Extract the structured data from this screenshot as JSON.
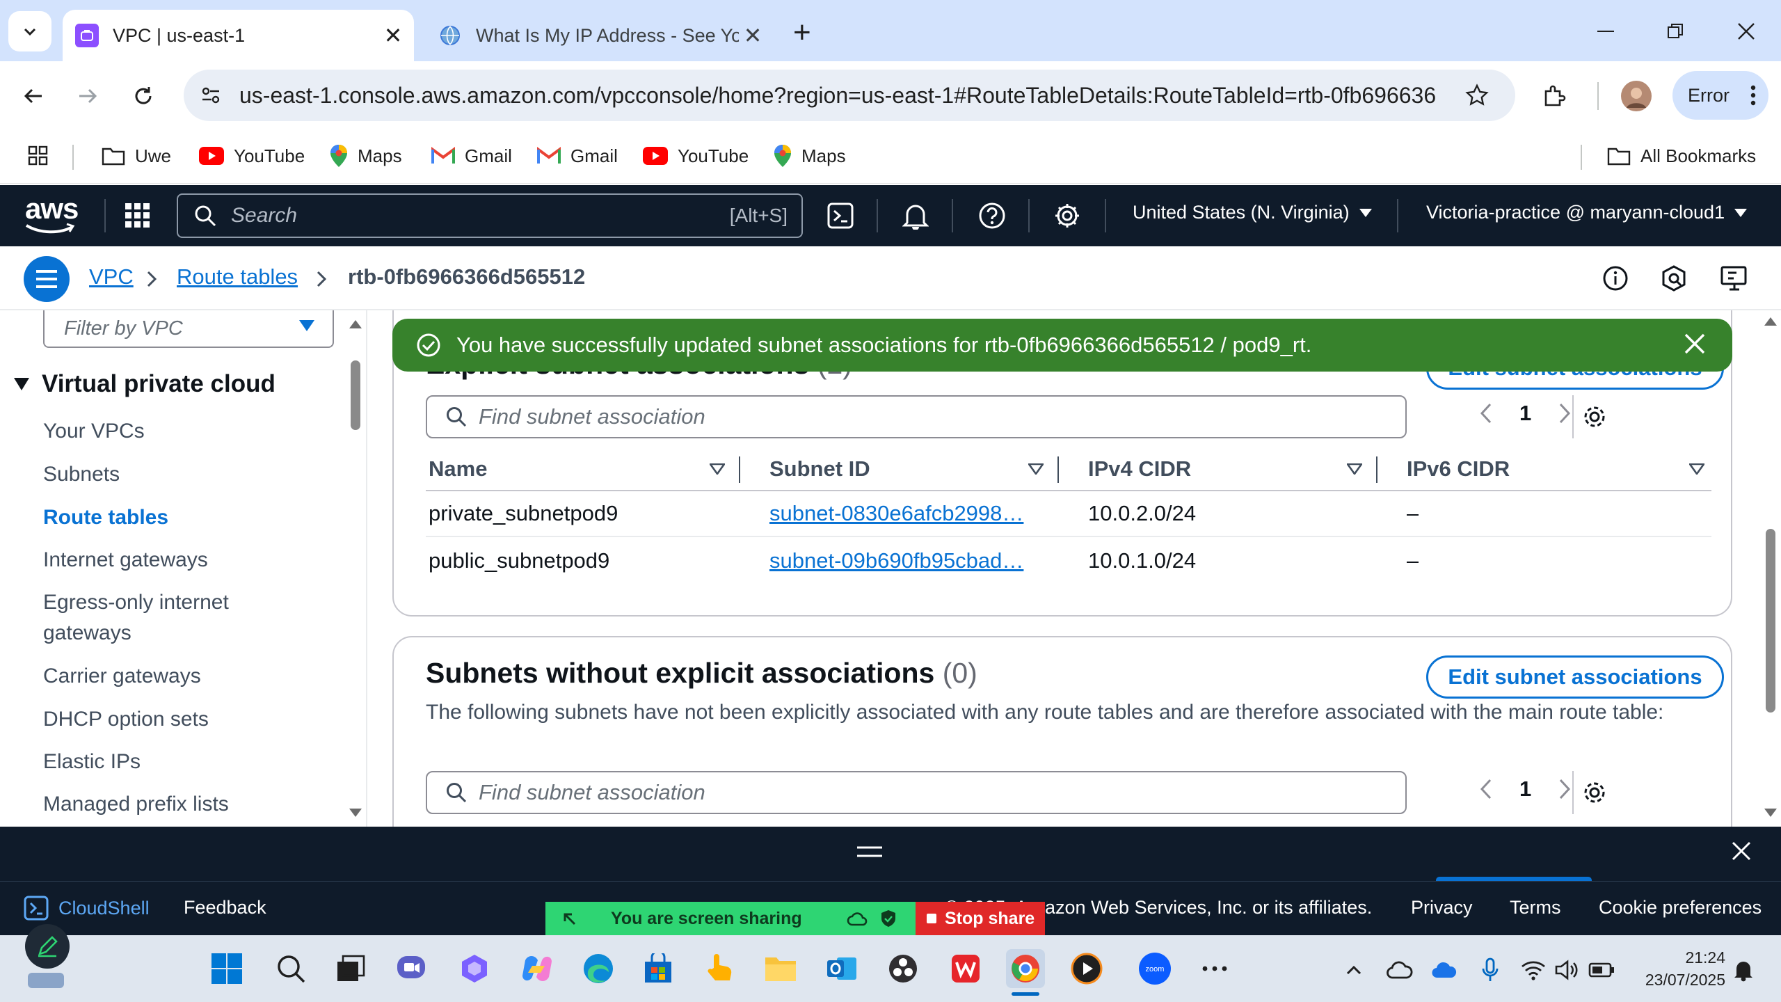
{
  "browser": {
    "tabs": [
      {
        "title": "VPC | us-east-1",
        "active": true
      },
      {
        "title": "What Is My IP Address - See Yo",
        "active": false
      }
    ],
    "url": "us-east-1.console.aws.amazon.com/vpcconsole/home?region=us-east-1#RouteTableDetails:RouteTableId=rtb-0fb6966366d56...",
    "profile_status": "Error",
    "bookmarks": [
      "Uwe",
      "YouTube",
      "Maps",
      "Gmail",
      "Gmail",
      "YouTube",
      "Maps"
    ],
    "all_bookmarks": "All Bookmarks"
  },
  "aws_header": {
    "logo": "aws",
    "search_placeholder": "Search",
    "search_shortcut": "[Alt+S]",
    "region": "United States (N. Virginia)",
    "account": "Victoria-practice @ maryann-cloud1"
  },
  "breadcrumb": {
    "items": [
      "VPC",
      "Route tables"
    ],
    "current": "rtb-0fb6966366d565512"
  },
  "sidebar": {
    "filter_placeholder": "Filter by VPC",
    "section": "Virtual private cloud",
    "items": [
      {
        "label": "Your VPCs",
        "active": false
      },
      {
        "label": "Subnets",
        "active": false
      },
      {
        "label": "Route tables",
        "active": true
      },
      {
        "label": "Internet gateways",
        "active": false
      },
      {
        "label": "Egress-only internet gateways",
        "active": false
      },
      {
        "label": "Carrier gateways",
        "active": false
      },
      {
        "label": "DHCP option sets",
        "active": false
      },
      {
        "label": "Elastic IPs",
        "active": false
      },
      {
        "label": "Managed prefix lists",
        "active": false
      }
    ]
  },
  "flash": {
    "message": "You have successfully updated subnet associations for rtb-0fb6966366d565512 / pod9_rt.",
    "color": "#37822c"
  },
  "explicit": {
    "title": "Explicit subnet associations",
    "count": "(2)",
    "edit_label": "Edit subnet associations",
    "find_placeholder": "Find subnet association",
    "page": "1",
    "columns": [
      "Name",
      "Subnet ID",
      "IPv4 CIDR",
      "IPv6 CIDR"
    ],
    "rows": [
      {
        "name": "private_subnetpod9",
        "subnet_id": "subnet-0830e6afcb2998…",
        "ipv4": "10.0.2.0/24",
        "ipv6": "–"
      },
      {
        "name": "public_subnetpod9",
        "subnet_id": "subnet-09b690fb95cbad…",
        "ipv4": "10.0.1.0/24",
        "ipv6": "–"
      }
    ]
  },
  "without": {
    "title": "Subnets without explicit associations",
    "count": "(0)",
    "edit_label": "Edit subnet associations",
    "description": "The following subnets have not been explicitly associated with any route tables and are therefore associated with the main route table:",
    "find_placeholder": "Find subnet association",
    "page": "1"
  },
  "footer": {
    "cloudshell": "CloudShell",
    "feedback": "Feedback",
    "copyright": "azon Web Services, Inc. or its affiliates.",
    "copyright_prefix": "© 2025, A",
    "privacy": "Privacy",
    "terms": "Terms",
    "cookies": "Cookie preferences"
  },
  "screen_share": {
    "sharing": "You are screen sharing",
    "stop": "Stop share"
  },
  "taskbar": {
    "time": "21:24",
    "date": "23/07/2025",
    "zoom_label": "zoom"
  },
  "colors": {
    "aws_nav": "#0f1b2a",
    "link": "#0972d3",
    "success": "#37822c"
  }
}
